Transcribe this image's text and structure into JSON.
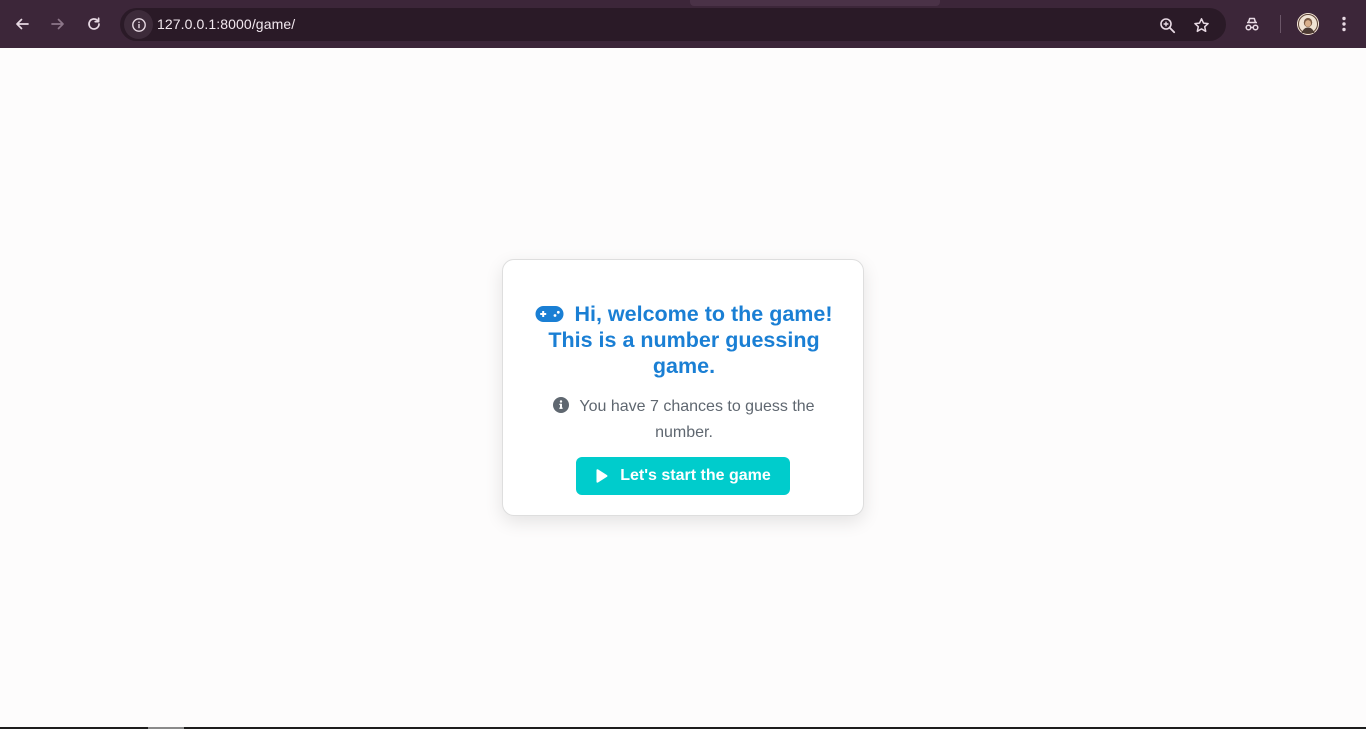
{
  "browser": {
    "url": "127.0.0.1:8000/game/",
    "icons": {
      "back": "arrow-left-icon",
      "forward": "arrow-right-icon",
      "reload": "reload-icon",
      "site_info": "info-icon",
      "zoom": "zoom-in-icon",
      "bookmark": "star-icon",
      "extension": "incognito-icon",
      "profile": "avatar",
      "menu": "kebab-menu-icon"
    },
    "colors": {
      "frame": "#3c2639",
      "omnibox": "#2a1a27",
      "text": "#f2e8ef"
    }
  },
  "card": {
    "title": "Hi, welcome to the game! This is a number guessing game.",
    "info_text": "You have 7 chances to guess the number.",
    "start_button_label": "Let's start the game",
    "icons": {
      "title": "gamepad-icon",
      "info": "info-circle-icon",
      "button": "play-icon"
    },
    "colors": {
      "title": "#1a7fd4",
      "text": "#5f6770",
      "button": "#00cccc"
    }
  }
}
